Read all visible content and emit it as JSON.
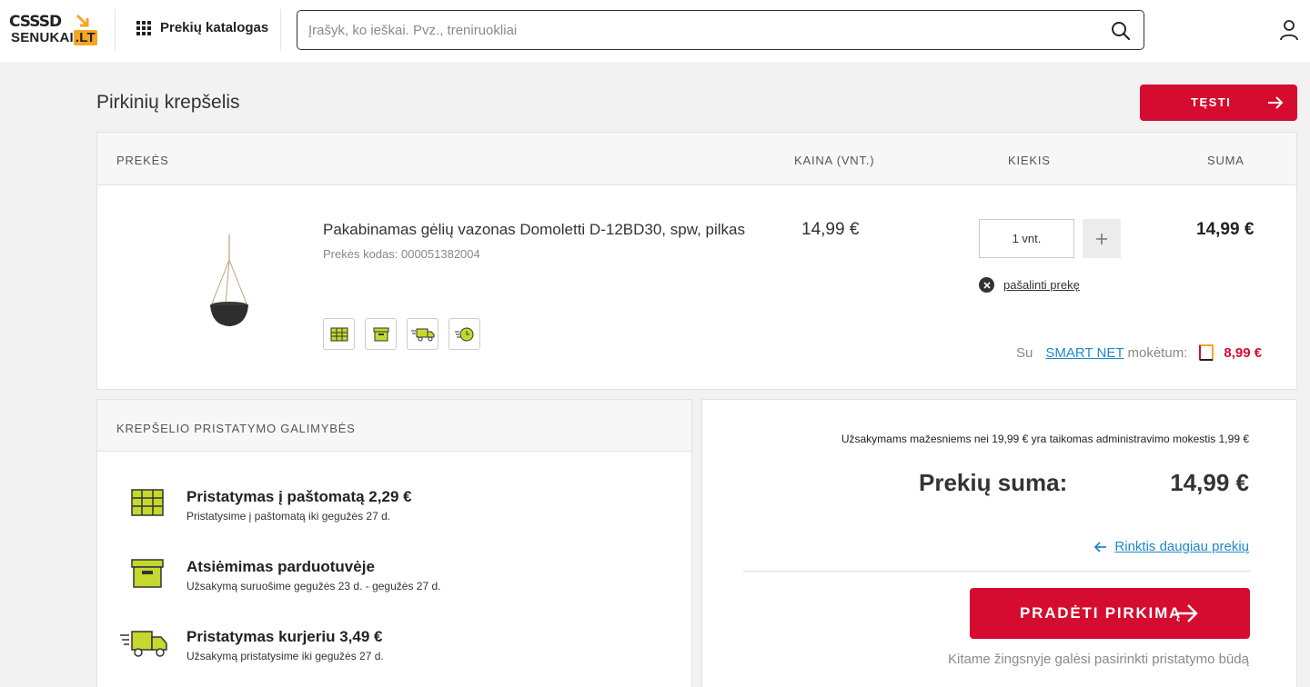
{
  "header": {
    "logo_top": "CSSSD",
    "logo_bottom": "SENUKAI",
    "logo_tld": ".LT",
    "catalog_label": "Prekių katalogas",
    "search_placeholder": "Įrašyk, ko ieškai. Pvz., treniruokliai"
  },
  "page": {
    "title": "Pirkinių krepšelis",
    "continue_label": "TĘSTI"
  },
  "cart": {
    "columns": [
      "PREKĖS",
      "KAINA (vnt.)",
      "KIEKIS",
      "SUMA"
    ],
    "item": {
      "name": "Pakabinamas gėlių vazonas Domoletti D-12BD30, spw, pilkas",
      "code": "Prekės kodas: 000051382004",
      "unit_price": "14,99 €",
      "quantity": "1 vnt.",
      "sum": "14,99 €",
      "remove_label": "pašalinti prekę",
      "delivery_icons": [
        "parcel-locker-icon",
        "store-box-icon",
        "courier-truck-icon",
        "express-clock-icon"
      ]
    },
    "smart": {
      "prefix": "Su",
      "link": "SMART NET",
      "suffix": "mokėtum:",
      "price": "8,99 €"
    }
  },
  "delivery": {
    "title": "KREPŠELIO PRISTATYMO GALIMYBĖS",
    "options": [
      {
        "title": "Pristatymas į paštomatą 2,29 €",
        "subtitle": "Pristatysime į paštomatą iki gegužės 27 d.",
        "icon": "parcel-locker-icon"
      },
      {
        "title": "Atsiėmimas parduotuvėje",
        "subtitle": "Užsakymą suruošime gegužės 23 d. - gegužės 27 d.",
        "icon": "store-box-icon"
      },
      {
        "title": "Pristatymas kurjeriu 3,49 €",
        "subtitle": "Užsakymą pristatysime iki gegužės 27 d.",
        "icon": "courier-truck-icon"
      }
    ]
  },
  "summary": {
    "admin_note": "Užsakymams mažesniems nei 19,99 € yra taikomas administravimo mokestis 1,99 €",
    "total_label": "Prekių suma:",
    "total_value": "14,99 €",
    "more_link": "Rinktis daugiau prekių",
    "checkout_label": "PRADĖTI PIRKIMĄ",
    "next_note": "Kitame žingsnyje galėsi pasirinkti pristatymo būdą"
  },
  "colors": {
    "accent_red": "#d50c2f",
    "link_blue": "#1e88c8",
    "icon_green": "#c4d82e",
    "logo_orange": "#f5a623"
  }
}
